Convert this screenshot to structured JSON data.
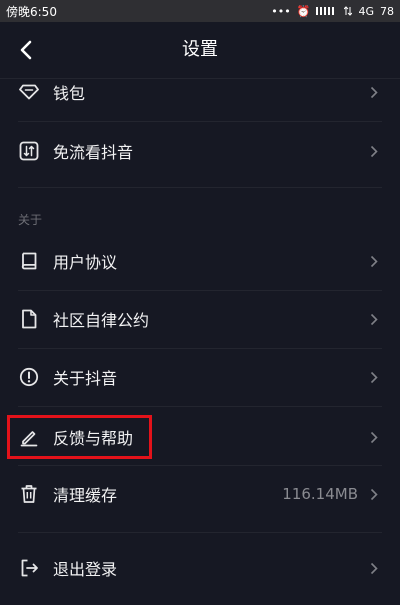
{
  "status_bar": {
    "time": "傍晚6:50",
    "network": "4G",
    "battery": "78"
  },
  "header": {
    "title": "设置"
  },
  "settings": {
    "wallet": {
      "label": "钱包",
      "icon": "diamond-icon"
    },
    "free_flow": {
      "label": "免流看抖音",
      "icon": "free-flow-icon"
    },
    "about_section": {
      "header": "关于"
    },
    "user_agreement": {
      "label": "用户协议",
      "icon": "book-icon"
    },
    "community": {
      "label": "社区自律公约",
      "icon": "document-icon"
    },
    "about_app": {
      "label": "关于抖音",
      "icon": "info-icon"
    },
    "feedback": {
      "label": "反馈与帮助",
      "icon": "pencil-icon"
    },
    "clear_cache": {
      "label": "清理缓存",
      "value": "116.14MB",
      "icon": "trash-icon"
    },
    "logout": {
      "label": "退出登录",
      "icon": "exit-icon"
    }
  },
  "colors": {
    "background": "#161823",
    "highlight": "#e3121a",
    "secondary_text": "#8a8b91"
  }
}
